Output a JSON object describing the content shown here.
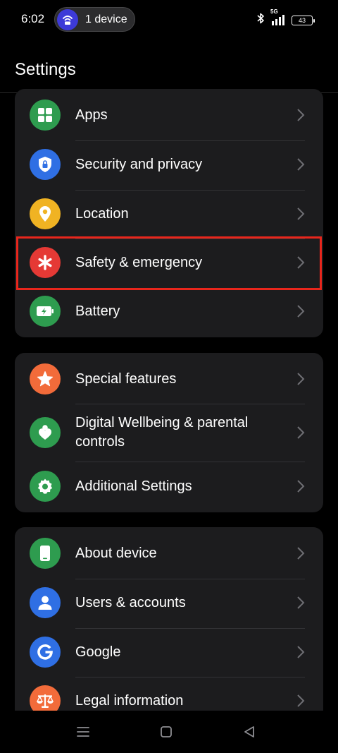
{
  "status_bar": {
    "time": "6:02",
    "device_pill": "1 device",
    "network": "5G",
    "battery": "43"
  },
  "header": {
    "title": "Settings"
  },
  "groups": [
    {
      "items": [
        {
          "label": "Apps",
          "icon": "apps-grid-icon",
          "color": "#2e9c4f"
        },
        {
          "label": "Security and privacy",
          "icon": "shield-lock-icon",
          "color": "#2f6fe4"
        },
        {
          "label": "Location",
          "icon": "location-pin-icon",
          "color": "#f0b323"
        },
        {
          "label": "Safety & emergency",
          "icon": "emergency-asterisk-icon",
          "color": "#e53935"
        },
        {
          "label": "Battery",
          "icon": "battery-icon",
          "color": "#2e9c4f"
        }
      ]
    },
    {
      "items": [
        {
          "label": "Special features",
          "icon": "star-icon",
          "color": "#f26b3a"
        },
        {
          "label": "Digital Wellbeing & parental controls",
          "icon": "wellbeing-heart-icon",
          "color": "#2e9c4f"
        },
        {
          "label": "Additional Settings",
          "icon": "gear-icon",
          "color": "#2e9c4f"
        }
      ]
    },
    {
      "items": [
        {
          "label": "About device",
          "icon": "phone-device-icon",
          "color": "#2e9c4f"
        },
        {
          "label": "Users & accounts",
          "icon": "user-icon",
          "color": "#2f6fe4"
        },
        {
          "label": "Google",
          "icon": "google-g-icon",
          "color": "#2f6fe4"
        },
        {
          "label": "Legal information",
          "icon": "scales-icon",
          "color": "#f26b3a"
        }
      ]
    }
  ],
  "highlight": {
    "color": "#e8261c",
    "target": "Safety & emergency"
  },
  "nav_bar": {
    "buttons": [
      "menu-icon",
      "home-square-icon",
      "back-triangle-icon"
    ]
  }
}
